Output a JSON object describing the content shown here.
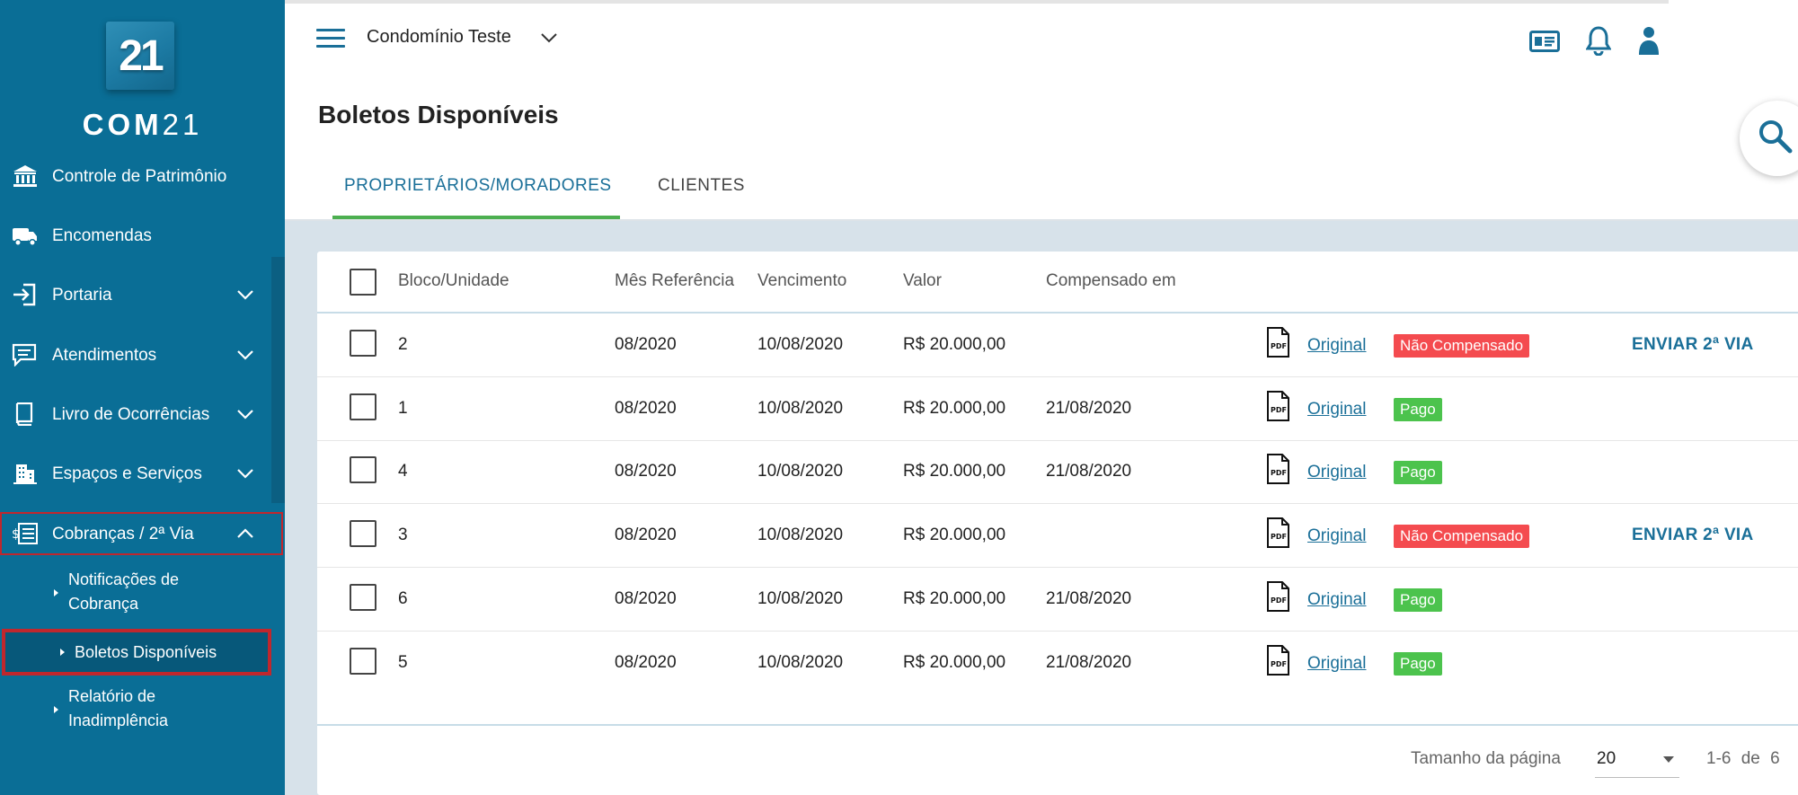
{
  "brand": {
    "logo_text": "21",
    "name_letters": "COM",
    "name_number": "21"
  },
  "sidebar": {
    "items": [
      {
        "label": "Controle de Patrimônio",
        "icon": "bank-icon"
      },
      {
        "label": "Encomendas",
        "icon": "truck-icon"
      },
      {
        "label": "Portaria",
        "icon": "login-icon"
      },
      {
        "label": "Atendimentos",
        "icon": "chat-icon"
      },
      {
        "label": "Livro de Ocorrências",
        "icon": "book-icon"
      },
      {
        "label": "Espaços e Serviços",
        "icon": "building-icon"
      },
      {
        "label": "Cobranças / 2ª Via",
        "icon": "billing-list-icon"
      }
    ],
    "subitems": [
      {
        "label_line1": "Notificações de",
        "label_line2": "Cobrança"
      },
      {
        "label": "Boletos Disponíveis"
      },
      {
        "label_line1": "Relatório de",
        "label_line2": "Inadimplência"
      }
    ]
  },
  "header": {
    "condominium": "Condomínio Teste"
  },
  "page": {
    "title": "Boletos Disponíveis"
  },
  "tabs": [
    {
      "label": "PROPRIETÁRIOS/MORADORES",
      "active": true
    },
    {
      "label": "CLIENTES",
      "active": false
    }
  ],
  "table": {
    "columns": [
      "Bloco/Unidade",
      "Mês Referência",
      "Vencimento",
      "Valor",
      "Compensado em"
    ],
    "original_label": "Original",
    "rows": [
      {
        "unit": "2",
        "month": "08/2020",
        "due": "10/08/2020",
        "value": "R$ 20.000,00",
        "compensated": "",
        "status": "Não Compensado",
        "action": "ENVIAR 2ª VIA"
      },
      {
        "unit": "1",
        "month": "08/2020",
        "due": "10/08/2020",
        "value": "R$ 20.000,00",
        "compensated": "21/08/2020",
        "status": "Pago",
        "action": ""
      },
      {
        "unit": "4",
        "month": "08/2020",
        "due": "10/08/2020",
        "value": "R$ 20.000,00",
        "compensated": "21/08/2020",
        "status": "Pago",
        "action": ""
      },
      {
        "unit": "3",
        "month": "08/2020",
        "due": "10/08/2020",
        "value": "R$ 20.000,00",
        "compensated": "",
        "status": "Não Compensado",
        "action": "ENVIAR 2ª VIA"
      },
      {
        "unit": "6",
        "month": "08/2020",
        "due": "10/08/2020",
        "value": "R$ 20.000,00",
        "compensated": "21/08/2020",
        "status": "Pago",
        "action": ""
      },
      {
        "unit": "5",
        "month": "08/2020",
        "due": "10/08/2020",
        "value": "R$ 20.000,00",
        "compensated": "21/08/2020",
        "status": "Pago",
        "action": ""
      }
    ]
  },
  "pagination": {
    "page_size_label": "Tamanho da página",
    "page_size": "20",
    "range": "1-6 de 6"
  },
  "colors": {
    "sidebar": "#0a6e96",
    "accent": "#1a6f98",
    "tab_underline": "#4caf50",
    "status_unpaid": "#f44b4f",
    "status_paid": "#4cc34d",
    "highlight_border": "#c0272d"
  }
}
